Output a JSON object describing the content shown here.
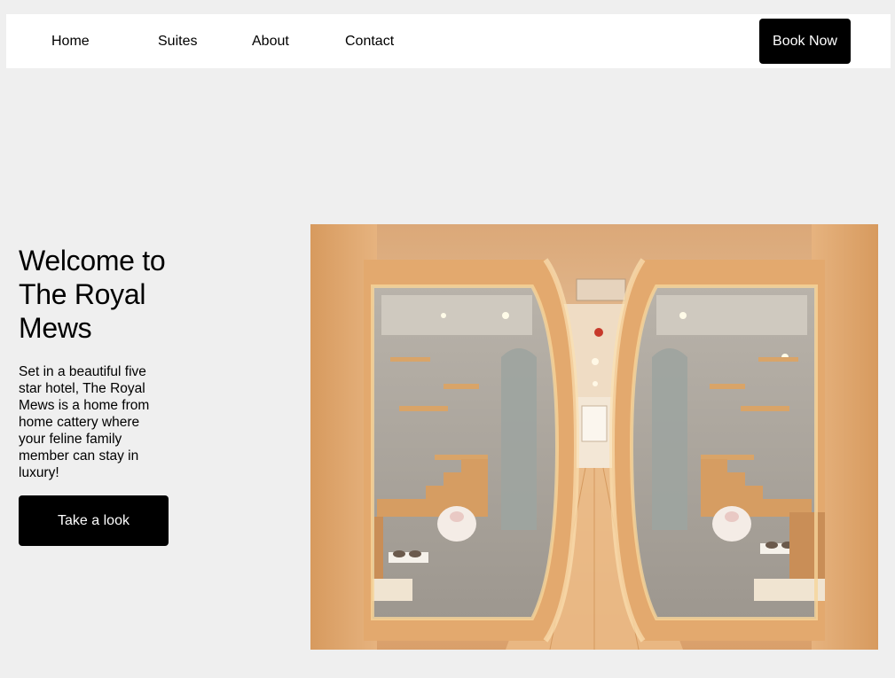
{
  "nav": {
    "links": [
      "Home",
      "Suites",
      "About",
      "Contact"
    ],
    "book_label": "Book Now"
  },
  "hero": {
    "title": "Welcome to The Royal Mews",
    "description": "Set in a beautiful five star hotel, The Royal Mews is a home from home cattery where your feline family member can stay in luxury!",
    "cta_label": "Take a look"
  },
  "colors": {
    "background": "#efefef",
    "nav_background": "#ffffff",
    "button": "#000000",
    "button_text": "#ffffff"
  }
}
